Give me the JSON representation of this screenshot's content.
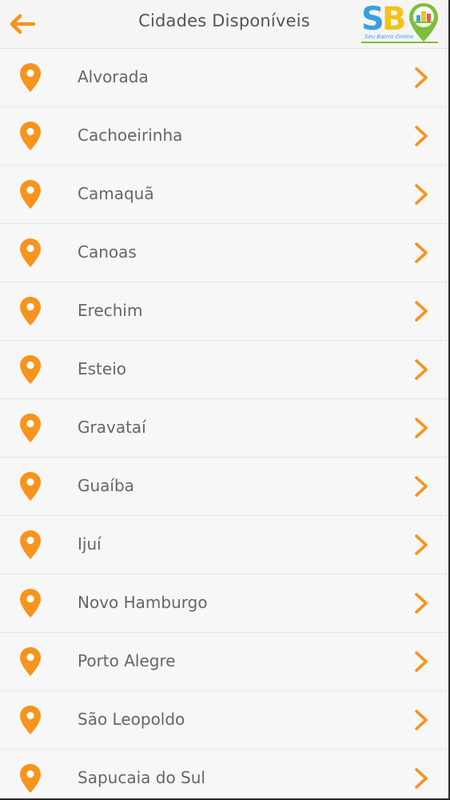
{
  "header": {
    "title": "Cidades Disponíveis",
    "back_icon": "arrow-left-icon",
    "logo": {
      "letter_s": "S",
      "letter_b": "B",
      "tagline": "Seu Bairro Online"
    }
  },
  "colors": {
    "accent": "#f7941d",
    "text": "#666666",
    "title": "#555555",
    "background": "#f7f7f7"
  },
  "cities": [
    {
      "name": "Alvorada"
    },
    {
      "name": "Cachoeirinha"
    },
    {
      "name": "Camaquã"
    },
    {
      "name": "Canoas"
    },
    {
      "name": "Erechim"
    },
    {
      "name": "Esteio"
    },
    {
      "name": "Gravataí"
    },
    {
      "name": "Guaíba"
    },
    {
      "name": "Ijuí"
    },
    {
      "name": "Novo Hamburgo"
    },
    {
      "name": "Porto Alegre"
    },
    {
      "name": "São Leopoldo"
    },
    {
      "name": "Sapucaia do Sul"
    }
  ]
}
